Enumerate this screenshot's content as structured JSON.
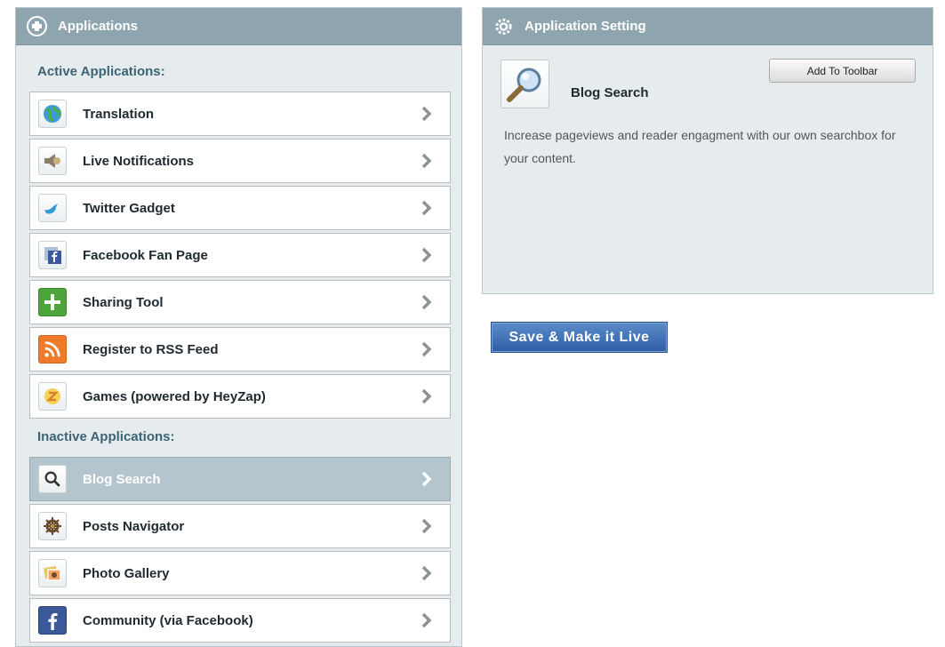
{
  "left_panel": {
    "title": "Applications",
    "active_title": "Active Applications:",
    "inactive_title": "Inactive Applications:",
    "active_apps": [
      {
        "label": "Translation",
        "icon": "globe-icon"
      },
      {
        "label": "Live Notifications",
        "icon": "speaker-icon"
      },
      {
        "label": "Twitter Gadget",
        "icon": "twitter-bird-icon"
      },
      {
        "label": "Facebook Fan Page",
        "icon": "facebook-page-icon"
      },
      {
        "label": "Sharing Tool",
        "icon": "plus-icon"
      },
      {
        "label": "Register to RSS Feed",
        "icon": "rss-icon"
      },
      {
        "label": "Games (powered by HeyZap)",
        "icon": "heyzap-icon"
      }
    ],
    "inactive_apps": [
      {
        "label": "Blog Search",
        "icon": "search-icon",
        "selected": true
      },
      {
        "label": "Posts Navigator",
        "icon": "ship-wheel-icon"
      },
      {
        "label": "Photo Gallery",
        "icon": "photo-icon"
      },
      {
        "label": "Community (via Facebook)",
        "icon": "facebook-icon"
      }
    ]
  },
  "right_panel": {
    "title": "Application Setting",
    "app_name": "Blog Search",
    "add_button": "Add To Toolbar",
    "description": "Increase pageviews and reader engagment with our own searchbox for your content."
  },
  "save_button": "Save & Make it Live",
  "colors": {
    "header": "#8ea5af",
    "panel_bg": "#e6ecee",
    "section_title": "#3c6475",
    "selected_row": "#b5c5cd",
    "save_button": "#3f6fb5"
  }
}
